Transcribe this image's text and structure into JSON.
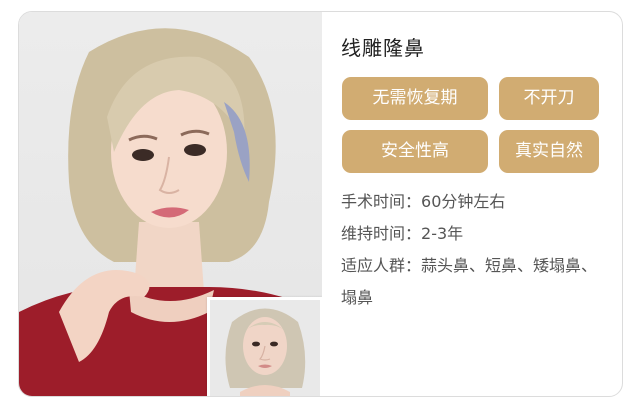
{
  "procedure": {
    "title": "线雕隆鼻",
    "tags": [
      "无需恢复期",
      "不开刀",
      "安全性高",
      "真实自然"
    ],
    "tag_color": "#d1ac72",
    "details": [
      {
        "label": "手术时间：",
        "value": "60分钟左右"
      },
      {
        "label": "维持时间：",
        "value": "2-3年"
      },
      {
        "label": "适应人群：",
        "value": "蒜头鼻、短鼻、矮塌鼻、"
      }
    ],
    "details_wrap": "塌鼻"
  },
  "images": {
    "main_photo": "after-portrait",
    "inset_photo": "before-portrait"
  }
}
